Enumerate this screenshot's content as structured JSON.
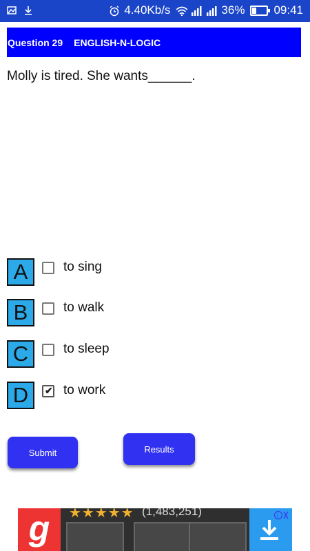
{
  "status_bar": {
    "speed": "4.40Kb/s",
    "battery": "36%",
    "time": "09:41",
    "battery_level": 0.36
  },
  "header": {
    "question_number": "Question 29",
    "app_name": "ENGLISH-N-LOGIC"
  },
  "question": {
    "text": "Molly is tired. She wants______."
  },
  "options": [
    {
      "letter": "A",
      "label": "to sing",
      "checked": false
    },
    {
      "letter": "B",
      "label": "to walk",
      "checked": false
    },
    {
      "letter": "C",
      "label": "to sleep",
      "checked": false
    },
    {
      "letter": "D",
      "label": "to work",
      "checked": true
    }
  ],
  "buttons": {
    "submit": "Submit",
    "results": "Results"
  },
  "ad": {
    "stars": "★★★★★",
    "count": "(1,483,251)",
    "logo": "g"
  },
  "colors": {
    "header": "#0000ff",
    "letter_box": "#2ba9e8",
    "button": "#3131f2",
    "status_bar": "#1a45c8"
  }
}
